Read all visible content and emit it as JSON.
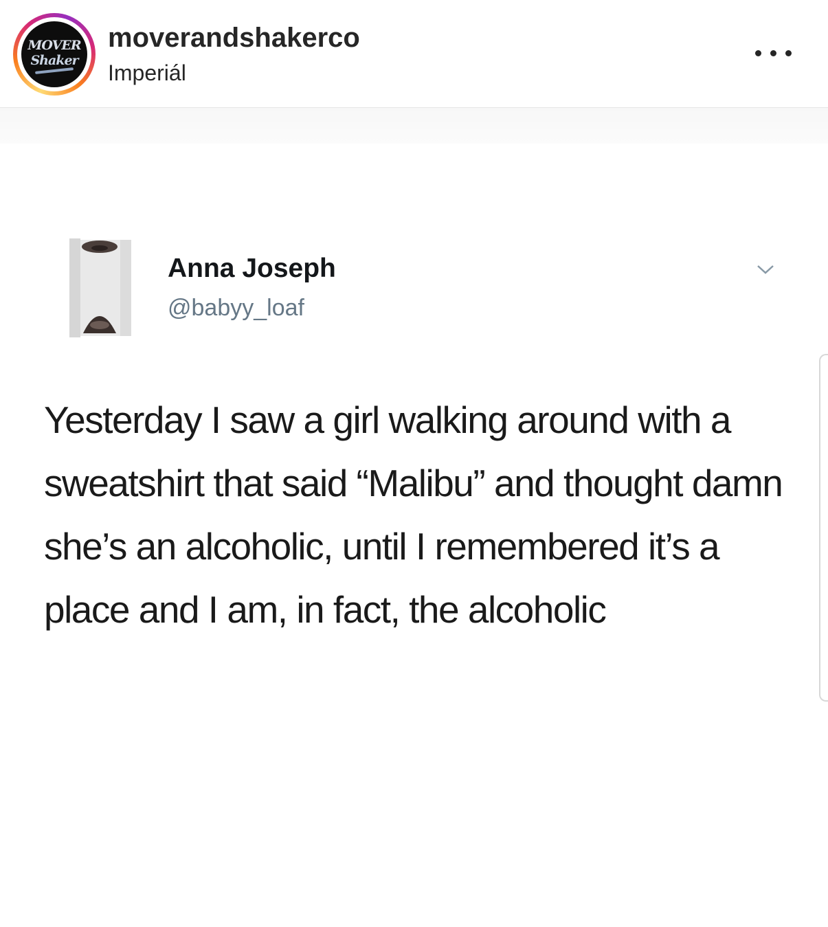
{
  "header": {
    "username": "moverandshakerco",
    "location": "Imperiál",
    "avatar_logo": {
      "line1": "MOVER",
      "line2": "Shaker",
      "icon": "mover-and-shaker-logo-icon"
    },
    "more_icon": "more-options-icon"
  },
  "tweet": {
    "display_name": "Anna Joseph",
    "handle": "@babyy_loaf",
    "body": "Yesterday I saw a girl walking around with a sweatshirt that said “Malibu” and thought damn she’s an alcoholic, until I remembered it’s a place and I am, in fact, the alcoholic",
    "avatar_icon": "profile-photo",
    "menu_icon": "chevron-down-icon"
  },
  "colors": {
    "ring_gradient": [
      "#feda75",
      "#fa7e1e",
      "#d62976",
      "#962fbf"
    ],
    "text_primary": "#262626",
    "handle_gray": "#657786"
  }
}
